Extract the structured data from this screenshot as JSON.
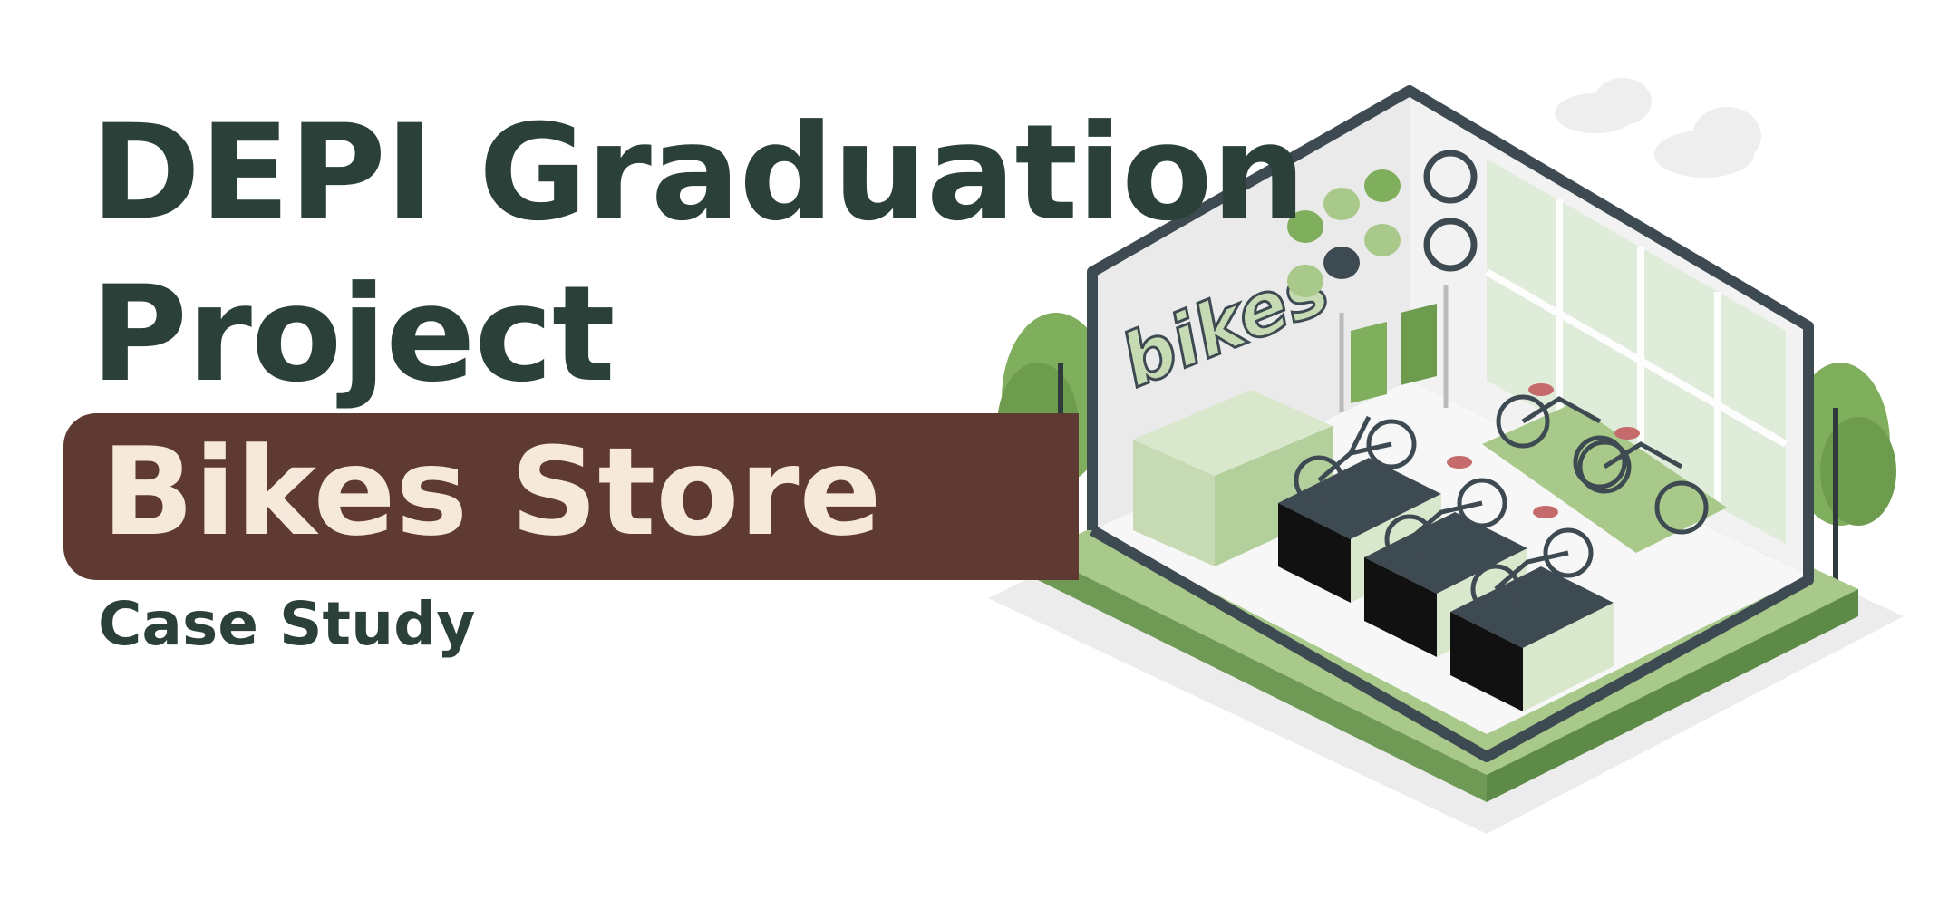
{
  "headline": {
    "line1": "DEPI Graduation",
    "line2": "Project"
  },
  "banner": {
    "text": "Bikes Store"
  },
  "subtitle": "Case Study",
  "illustration": {
    "sign_text": "bikes"
  },
  "colors": {
    "headline": "#2b4038",
    "banner_bg": "#5e3a32",
    "banner_text": "#f6e9dc",
    "accent_green": "#6f9a55",
    "light_green": "#c6dbb4",
    "frame": "#3e4a52"
  }
}
